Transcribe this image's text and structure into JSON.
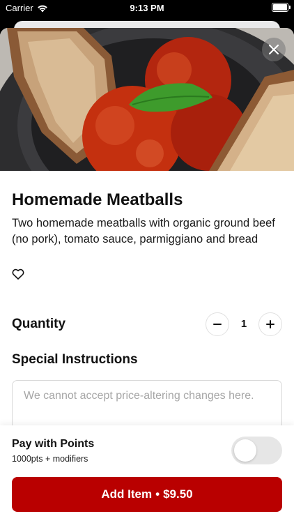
{
  "status_bar": {
    "carrier": "Carrier",
    "time": "9:13 PM"
  },
  "item": {
    "title": "Homemade Meatballs",
    "description": "Two homemade meatballs with organic ground beef (no pork), tomato sauce, parmiggiano and bread",
    "image_icon": "meatballs-photo"
  },
  "quantity": {
    "label": "Quantity",
    "value": "1"
  },
  "special_instructions": {
    "label": "Special Instructions",
    "value": "",
    "placeholder": "We cannot accept price-altering changes here."
  },
  "points": {
    "title": "Pay with Points",
    "subtitle": "1000pts + modifiers",
    "enabled": false
  },
  "add_button": {
    "label": "Add Item",
    "separator": "•",
    "price": "$9.50"
  },
  "colors": {
    "primary": "#b90000",
    "toggle_off": "#e6e6e6"
  }
}
